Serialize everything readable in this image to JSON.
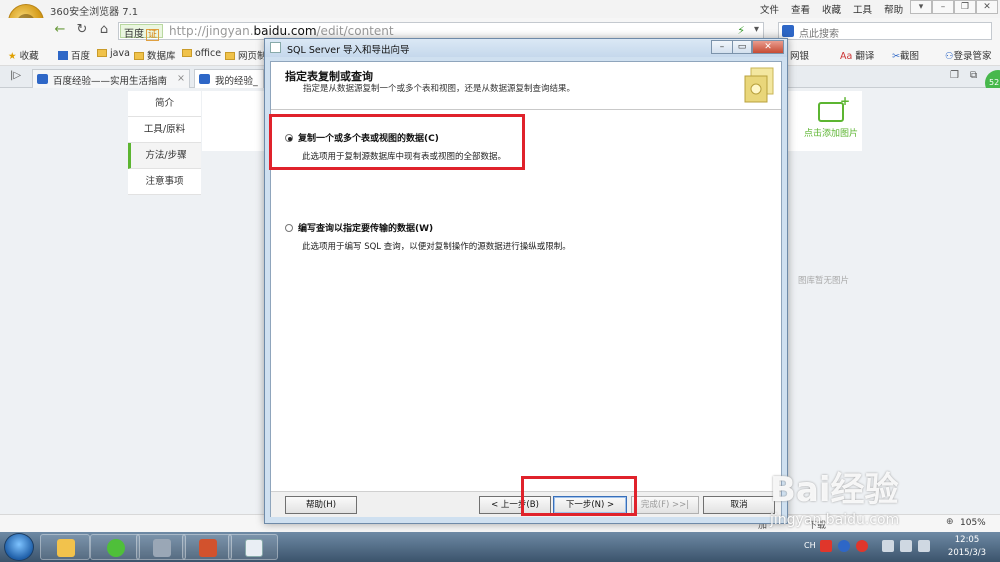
{
  "browser": {
    "app_title": "360安全浏览器 7.1",
    "menu": [
      "文件",
      "查看",
      "收藏",
      "工具",
      "帮助"
    ],
    "address": {
      "search_engine": "百度",
      "cert_badge": "证",
      "url_prefix": "http://jingyan.",
      "url_domain": "baidu.com",
      "url_path": "/edit/content"
    },
    "search_placeholder": "点此搜索",
    "favorites": [
      {
        "label": "收藏"
      },
      {
        "label": "百度"
      },
      {
        "label": "java"
      },
      {
        "label": "数据库"
      },
      {
        "label": "office"
      },
      {
        "label": "网页制"
      }
    ],
    "favorites_right": [
      {
        "label": "网银"
      },
      {
        "label": "翻译"
      },
      {
        "label": "截图"
      },
      {
        "label": "登录管家"
      }
    ],
    "tabs": [
      {
        "label": "百度经验——实用生活指南"
      },
      {
        "label": "我的经验_个"
      }
    ],
    "avatar_text": "52"
  },
  "page": {
    "side_nav": [
      "简介",
      "工具/原料",
      "方法/步骤",
      "注意事项"
    ],
    "side_nav_active": 2,
    "add_image_label": "点击添加图片",
    "no_image_label": "图库暂无图片"
  },
  "dialog": {
    "title": "SQL Server 导入和导出向导",
    "heading": "指定表复制或查询",
    "subheading": "指定是从数据源复制一个或多个表和视图，还是从数据源复制查询结果。",
    "options": [
      {
        "label": "复制一个或多个表或视图的数据(C)",
        "description": "此选项用于复制源数据库中现有表或视图的全部数据。",
        "selected": true
      },
      {
        "label": "编写查询以指定要传输的数据(W)",
        "description": "此选项用于编写 SQL 查询，以便对复制操作的源数据进行操纵或限制。",
        "selected": false
      }
    ],
    "buttons": {
      "help": "帮助(H)",
      "back": "< 上一步(B)",
      "next": "下一步(N) >",
      "finish": "完成(F) >>|",
      "cancel": "取消"
    }
  },
  "statusbar": {
    "zoom": "105%",
    "add": "加",
    "download": "下载"
  },
  "taskbar": {
    "lang": "CH",
    "time": "12:05",
    "date": "2015/3/3"
  },
  "watermark": {
    "brand": "Bai经验",
    "url": "jingyan.baidu.com"
  },
  "colors": {
    "highlight_box": "#e0222b",
    "accent_green": "#5cb531"
  }
}
